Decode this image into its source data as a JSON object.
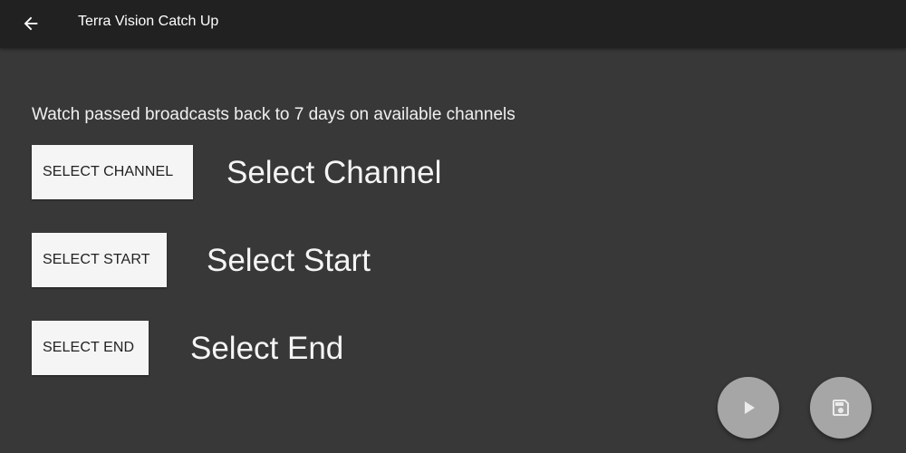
{
  "app_bar": {
    "title": "Terra Vision Catch Up",
    "back_icon": "arrow-back-icon"
  },
  "main": {
    "description": "Watch passed broadcasts back to 7 days on available channels",
    "rows": [
      {
        "button_label": "SELECT CHANNEL",
        "value_label": "Select Channel"
      },
      {
        "button_label": "SELECT START",
        "value_label": "Select Start"
      },
      {
        "button_label": "SELECT END",
        "value_label": "Select End"
      }
    ]
  },
  "fabs": {
    "play_icon": "play-icon",
    "save_icon": "save-icon"
  },
  "colors": {
    "background": "#383838",
    "app_bar": "#212121",
    "button_bg": "#f5f5f5",
    "fab_bg": "#a6a6a6",
    "fab_icon": "#ebebeb"
  }
}
